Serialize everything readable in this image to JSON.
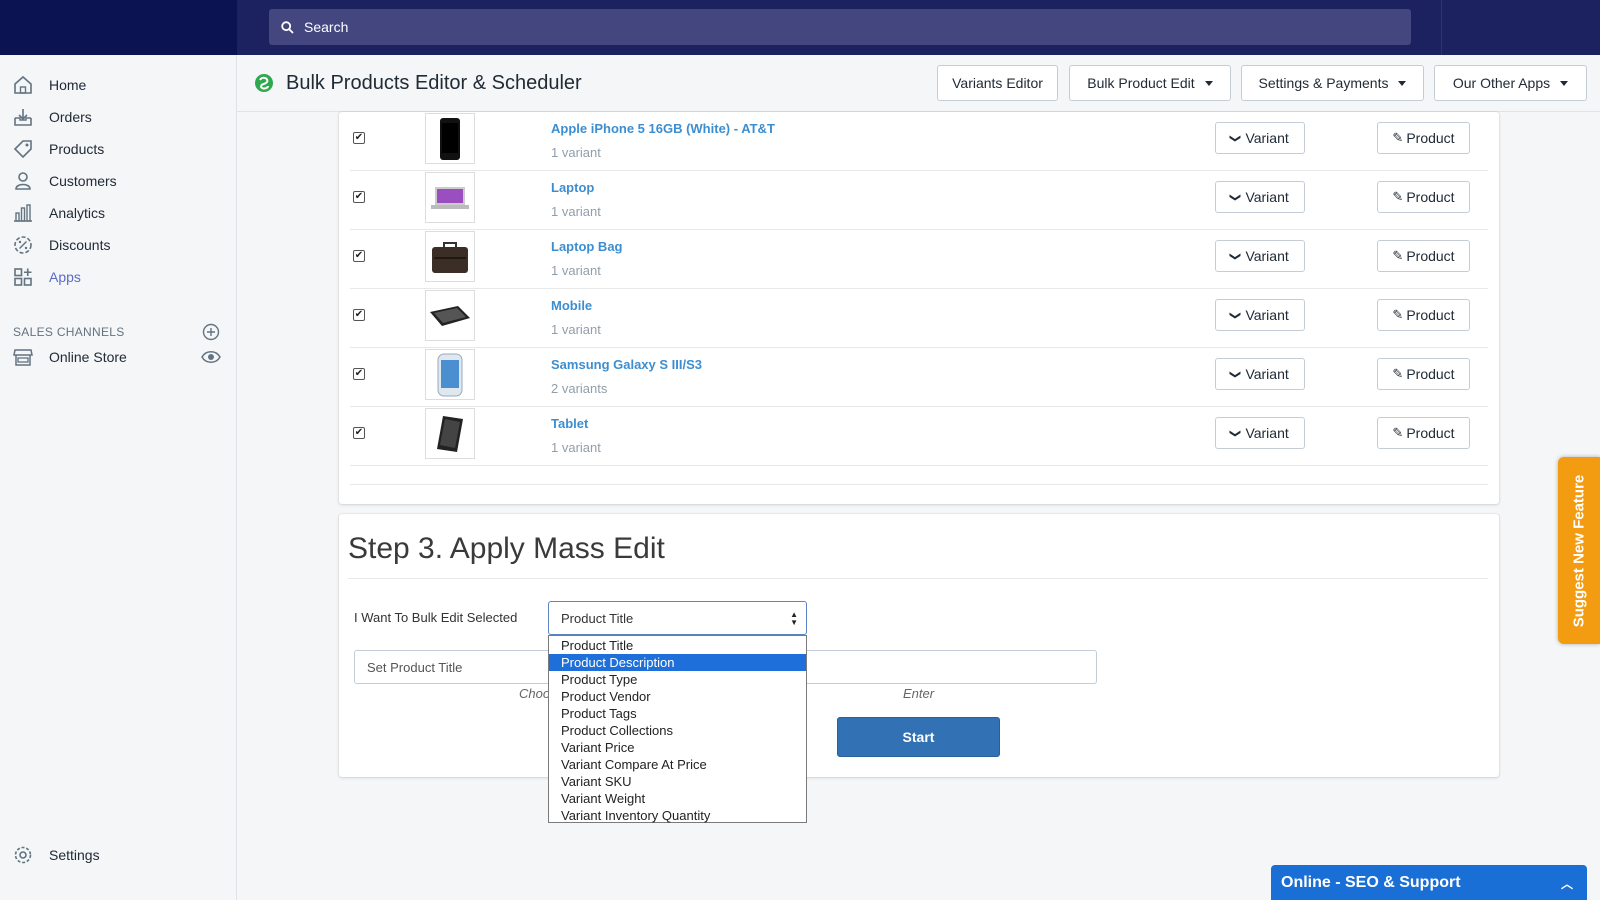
{
  "topbar": {
    "search_placeholder": "Search"
  },
  "sidebar": {
    "items": [
      {
        "label": "Home",
        "icon": "home-icon"
      },
      {
        "label": "Orders",
        "icon": "orders-icon"
      },
      {
        "label": "Products",
        "icon": "tag-icon"
      },
      {
        "label": "Customers",
        "icon": "person-icon"
      },
      {
        "label": "Analytics",
        "icon": "bar-chart-icon"
      },
      {
        "label": "Discounts",
        "icon": "discount-icon"
      },
      {
        "label": "Apps",
        "icon": "apps-icon"
      }
    ],
    "sales_channels_label": "SALES CHANNELS",
    "online_store_label": "Online Store",
    "settings_label": "Settings"
  },
  "header": {
    "title": "Bulk Products Editor & Scheduler",
    "buttons": {
      "variants_editor": "Variants Editor",
      "bulk_product_edit": "Bulk Product Edit",
      "settings_payments": "Settings & Payments",
      "other_apps": "Our Other Apps"
    }
  },
  "products": [
    {
      "name": "Apple iPhone 5 16GB (White) - AT&T",
      "variants": "1 variant"
    },
    {
      "name": "Laptop",
      "variants": "1 variant"
    },
    {
      "name": "Laptop Bag",
      "variants": "1 variant"
    },
    {
      "name": "Mobile",
      "variants": "1 variant"
    },
    {
      "name": "Samsung Galaxy S III/S3",
      "variants": "2 variants"
    },
    {
      "name": "Tablet",
      "variants": "1 variant"
    }
  ],
  "row_buttons": {
    "variant": "Variant",
    "product": "Product"
  },
  "step3": {
    "title": "Step 3. Apply Mass Edit",
    "bulk_label": "I Want To Bulk Edit Selected",
    "select_value": "Product Title",
    "set_input_placeholder": "Set Product Title",
    "hint_left": "Choo",
    "hint_right": "Enter",
    "start_label": "Start",
    "options": [
      "Product Title",
      "Product Description",
      "Product Type",
      "Product Vendor",
      "Product Tags",
      "Product Collections",
      "Variant Price",
      "Variant Compare At Price",
      "Variant SKU",
      "Variant Weight",
      "Variant Inventory Quantity"
    ],
    "highlighted_option": "Product Description"
  },
  "suggest_label": "Suggest New Feature",
  "chat_label": "Online - SEO & Support",
  "colors": {
    "topbar": "#1c2260",
    "link": "#3d8ed0",
    "primary": "#3171b4",
    "accent_orange": "#f39c12",
    "chat": "#1a6fd6"
  }
}
